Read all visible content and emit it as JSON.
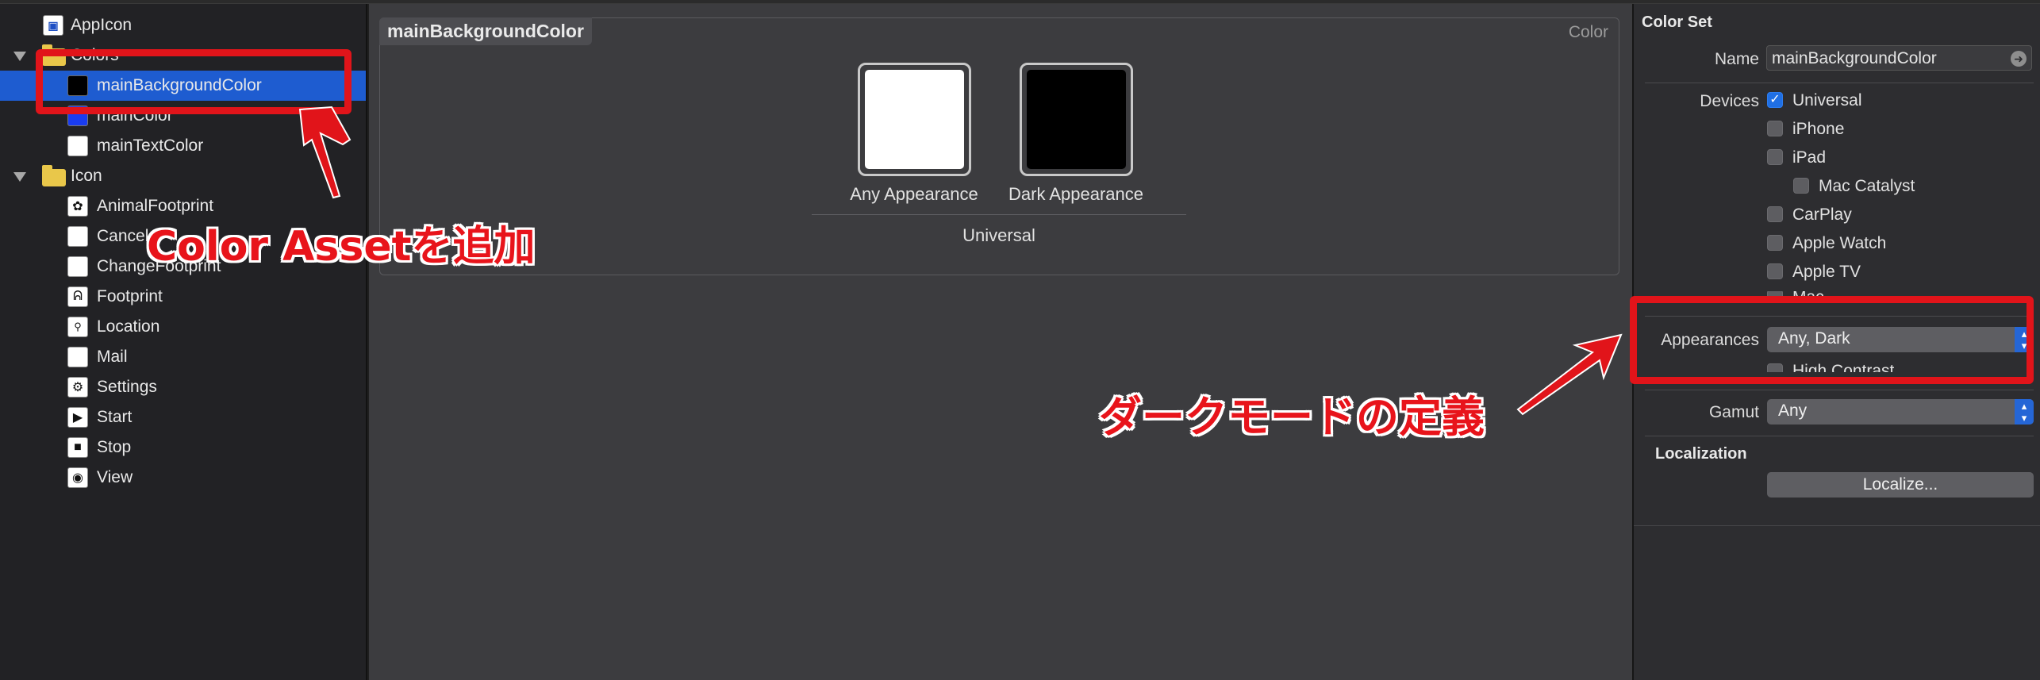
{
  "sidebar": {
    "items": [
      {
        "label": "AppIcon",
        "icon": "app-icon-asset"
      },
      {
        "label": "Colors",
        "icon": "folder-icon"
      },
      {
        "label": "mainBackgroundColor",
        "icon": "black-swatch-icon"
      },
      {
        "label": "mainColor",
        "icon": "blue-swatch-icon"
      },
      {
        "label": "mainTextColor",
        "icon": "white-swatch-icon"
      },
      {
        "label": "Icon",
        "icon": "folder-icon"
      },
      {
        "label": "AnimalFootprint",
        "icon": "paw-icon"
      },
      {
        "label": "Cancel",
        "icon": "cancel-icon"
      },
      {
        "label": "ChangeFootprint",
        "icon": "change-footprint-icon"
      },
      {
        "label": "Footprint",
        "icon": "footprint-icon"
      },
      {
        "label": "Location",
        "icon": "location-icon"
      },
      {
        "label": "Mail",
        "icon": "mail-icon"
      },
      {
        "label": "Settings",
        "icon": "gear-icon"
      },
      {
        "label": "Start",
        "icon": "play-icon"
      },
      {
        "label": "Stop",
        "icon": "stop-icon"
      },
      {
        "label": "View",
        "icon": "eye-icon"
      }
    ]
  },
  "editor": {
    "title": "mainBackgroundColor",
    "tag": "Color",
    "wells": [
      {
        "label": "Any Appearance",
        "color": "#ffffff"
      },
      {
        "label": "Dark Appearance",
        "color": "#000000"
      }
    ],
    "footer": "Universal"
  },
  "inspector": {
    "section": "Color Set",
    "name_label": "Name",
    "name_value": "mainBackgroundColor",
    "devices_label": "Devices",
    "devices": [
      {
        "label": "Universal",
        "checked": true
      },
      {
        "label": "iPhone",
        "checked": false
      },
      {
        "label": "iPad",
        "checked": false
      },
      {
        "label": "Mac Catalyst",
        "checked": false
      },
      {
        "label": "CarPlay",
        "checked": false
      },
      {
        "label": "Apple Watch",
        "checked": false
      },
      {
        "label": "Apple TV",
        "checked": false
      },
      {
        "label": "Mac",
        "checked": false
      }
    ],
    "appearances_label": "Appearances",
    "appearances_value": "Any, Dark",
    "high_contrast_label": "High Contrast",
    "gamut_label": "Gamut",
    "gamut_value": "Any",
    "localization_label": "Localization",
    "localize_button": "Localize..."
  },
  "annotations": {
    "color_asset_note": "Color Assetを追加",
    "dark_mode_note": "ダークモードの定義",
    "accent": "#e1141a"
  }
}
